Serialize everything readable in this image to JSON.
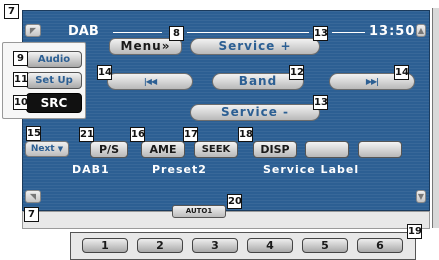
{
  "header": {
    "source_label": "DAB",
    "clock": "13:50"
  },
  "menu_button": "Menu»",
  "buttons": {
    "service_plus": "Service +",
    "service_minus": "Service -",
    "band": "Band",
    "prev": "|◀◀",
    "next": "▶▶|",
    "next_small": "Next",
    "ps": "P/S",
    "ame": "AME",
    "seek": "SEEK",
    "disp": "DISP",
    "auto": "AUTO1"
  },
  "side_menu": {
    "audio": "Audio",
    "setup": "Set Up",
    "src": "SRC"
  },
  "status": {
    "band_name": "DAB1",
    "preset_name": "Preset2",
    "service_label": "Service Label"
  },
  "presets": [
    "1",
    "2",
    "3",
    "4",
    "5",
    "6"
  ],
  "callouts": {
    "c7_top": "7",
    "c7_bottom": "7",
    "c8": "8",
    "c9": "9",
    "c10": "10",
    "c11": "11",
    "c12": "12",
    "c13_top": "13",
    "c13_mid": "13",
    "c14_left": "14",
    "c14_right": "14",
    "c15": "15",
    "c16": "16",
    "c17": "17",
    "c18": "18",
    "c19": "19",
    "c20": "20",
    "c21": "21"
  },
  "icons": {
    "scroll_up": "volume-up-icon",
    "scroll_down": "volume-down-icon",
    "next_arrow": "chevron-down-icon"
  },
  "colors": {
    "screen_bg": "#2c5f93",
    "button_text": "#2c5f93",
    "src_bg": "#111111"
  }
}
